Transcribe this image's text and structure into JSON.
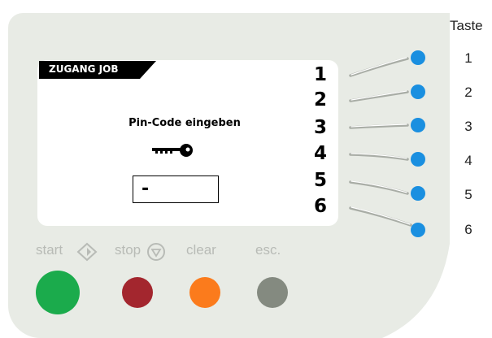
{
  "display": {
    "header_title": "ZUGANG JOB",
    "prompt": "Pin-Code eingeben",
    "pin_value": "-",
    "key_icon": "key-icon"
  },
  "softkeys": {
    "numbers": [
      "1",
      "2",
      "3",
      "4",
      "5",
      "6"
    ],
    "indicator_color": "#1a8fe0"
  },
  "taste_column": {
    "title": "Taste",
    "numbers": [
      "1",
      "2",
      "3",
      "4",
      "5",
      "6"
    ]
  },
  "controls": {
    "start": {
      "label": "start",
      "icon": "diamond-arrow-icon",
      "color": "#1bab4c"
    },
    "stop": {
      "label": "stop",
      "icon": "stop-triangle-icon",
      "color": "#a3262e"
    },
    "clear": {
      "label": "clear",
      "color": "#fb7b1c"
    },
    "esc": {
      "label": "esc.",
      "color": "#848a80"
    }
  },
  "colors": {
    "panel": "#e8ebe5",
    "screen": "#ffffff",
    "label_gray": "#b8bbb6"
  }
}
